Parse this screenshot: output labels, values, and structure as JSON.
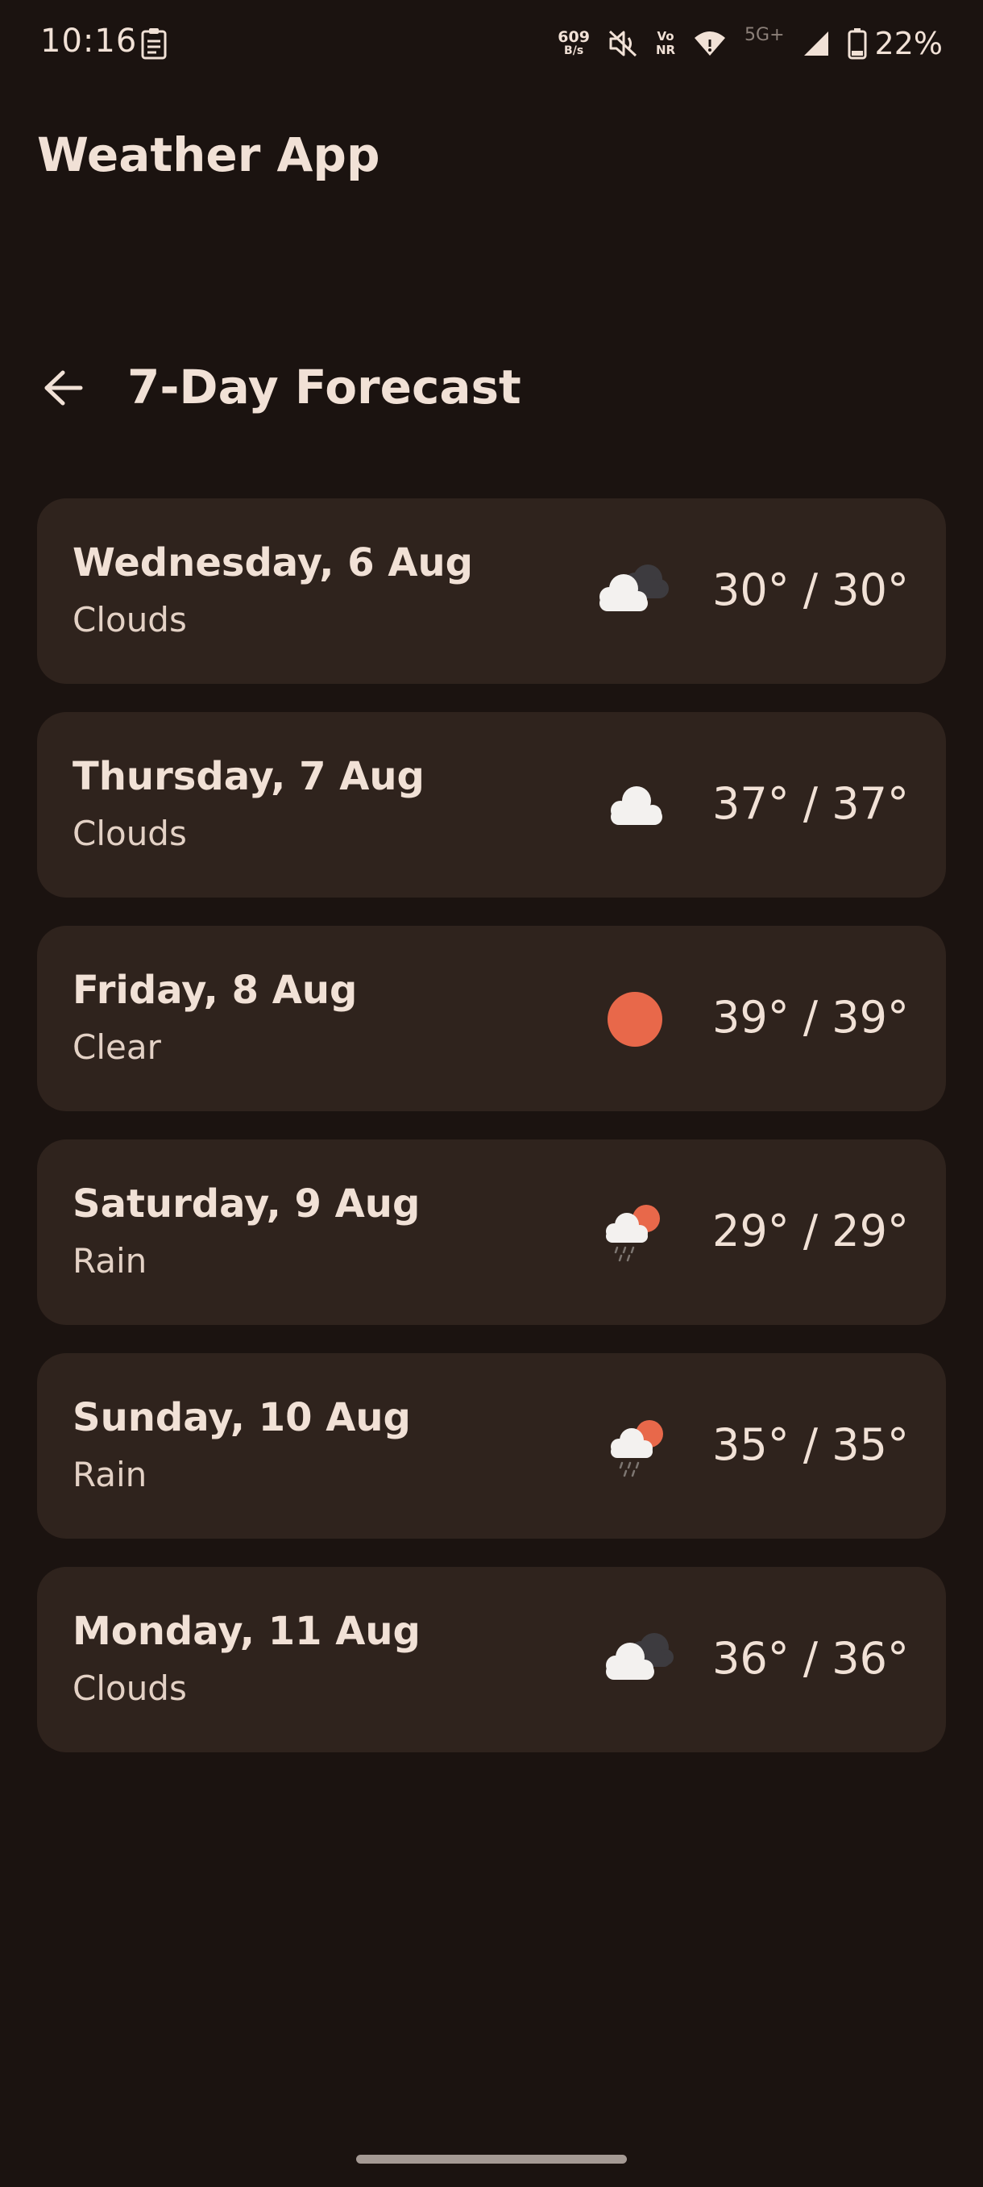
{
  "status_bar": {
    "time": "10:16",
    "net_speed_value": "609",
    "net_speed_unit": "B/s",
    "volte_top": "Vo",
    "volte_bottom": "NR",
    "network_type": "5G+",
    "battery": "22%"
  },
  "app": {
    "title": "Weather App"
  },
  "header": {
    "title": "7-Day Forecast"
  },
  "forecast": [
    {
      "day": "Wednesday, 6 Aug",
      "condition": "Clouds",
      "temp": "30° / 30°",
      "icon": "cloudy-icon"
    },
    {
      "day": "Thursday, 7 Aug",
      "condition": "Clouds",
      "temp": "37° / 37°",
      "icon": "cloud-icon"
    },
    {
      "day": "Friday, 8 Aug",
      "condition": "Clear",
      "temp": "39° / 39°",
      "icon": "sun-icon"
    },
    {
      "day": "Saturday, 9 Aug",
      "condition": "Rain",
      "temp": "29° / 29°",
      "icon": "rain-sun-icon"
    },
    {
      "day": "Sunday, 10 Aug",
      "condition": "Rain",
      "temp": "35° / 35°",
      "icon": "rain-sun-icon"
    },
    {
      "day": "Monday, 11 Aug",
      "condition": "Clouds",
      "temp": "36° / 36°",
      "icon": "cloudy-icon"
    }
  ],
  "colors": {
    "background": "#1b1310",
    "card": "#2f231d",
    "text": "#f1e1d6",
    "accent_sun": "#e8684a",
    "cloud": "#f3f1ef"
  }
}
